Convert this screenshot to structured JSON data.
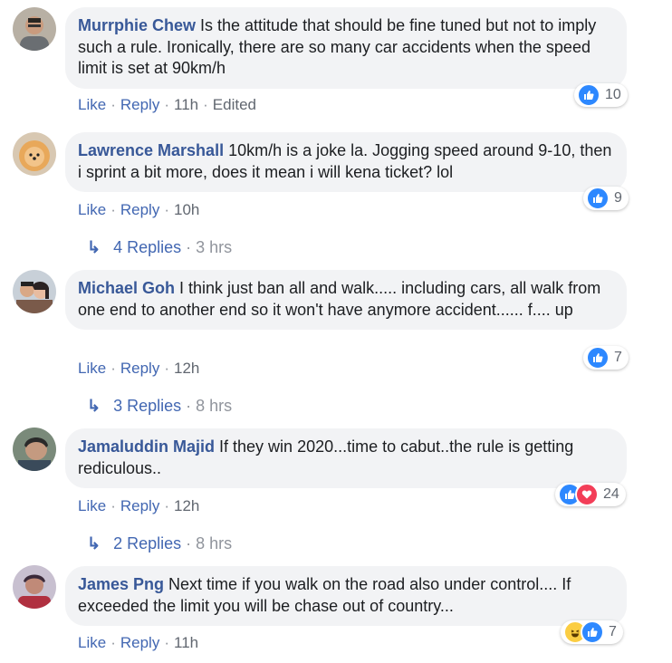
{
  "comments": [
    {
      "author": "Murrphie Chew",
      "text": " Is the attitude that should be fine tuned but not to imply such a rule. Ironically, there are so many car accidents when the speed limit is set at 90km/h",
      "like": "Like",
      "reply": "Reply",
      "time": "11h",
      "edited": "Edited",
      "reactions": [
        "like"
      ],
      "reaction_count": "10"
    },
    {
      "author": "Lawrence Marshall",
      "text": " 10km/h is a joke la. Jogging speed around 9-10, then i sprint a bit more, does it mean i will kena ticket? lol",
      "like": "Like",
      "reply": "Reply",
      "time": "10h",
      "reactions": [
        "like"
      ],
      "reaction_count": "9",
      "replies_label": "4 Replies",
      "replies_time": "3 hrs"
    },
    {
      "author": "Michael Goh",
      "text": " I think just ban all and walk..... including cars, all walk from one end to another end so it won't have anymore accident...... f.... up",
      "like": "Like",
      "reply": "Reply",
      "time": "12h",
      "reactions": [
        "like"
      ],
      "reaction_count": "7",
      "replies_label": "3 Replies",
      "replies_time": "8 hrs"
    },
    {
      "author": "Jamaluddin Majid",
      "text": " If they win 2020...time to cabut..the rule is getting rediculous..",
      "like": "Like",
      "reply": "Reply",
      "time": "12h",
      "reactions": [
        "like",
        "love"
      ],
      "reaction_count": "24",
      "replies_label": "2 Replies",
      "replies_time": "8 hrs"
    },
    {
      "author": "James Png",
      "text": " Next time if you walk on the road also under control.... If exceeded the limit you will be chase out of country...",
      "like": "Like",
      "reply": "Reply",
      "time": "11h",
      "reactions": [
        "haha",
        "like"
      ],
      "reaction_count": "7"
    }
  ],
  "colors": {
    "author": "#385898",
    "link": "#4267b2",
    "bubble": "#f2f3f5",
    "like_reaction": "#2d88ff",
    "love_reaction": "#f33e58",
    "haha_reaction": "#fbcd42"
  }
}
